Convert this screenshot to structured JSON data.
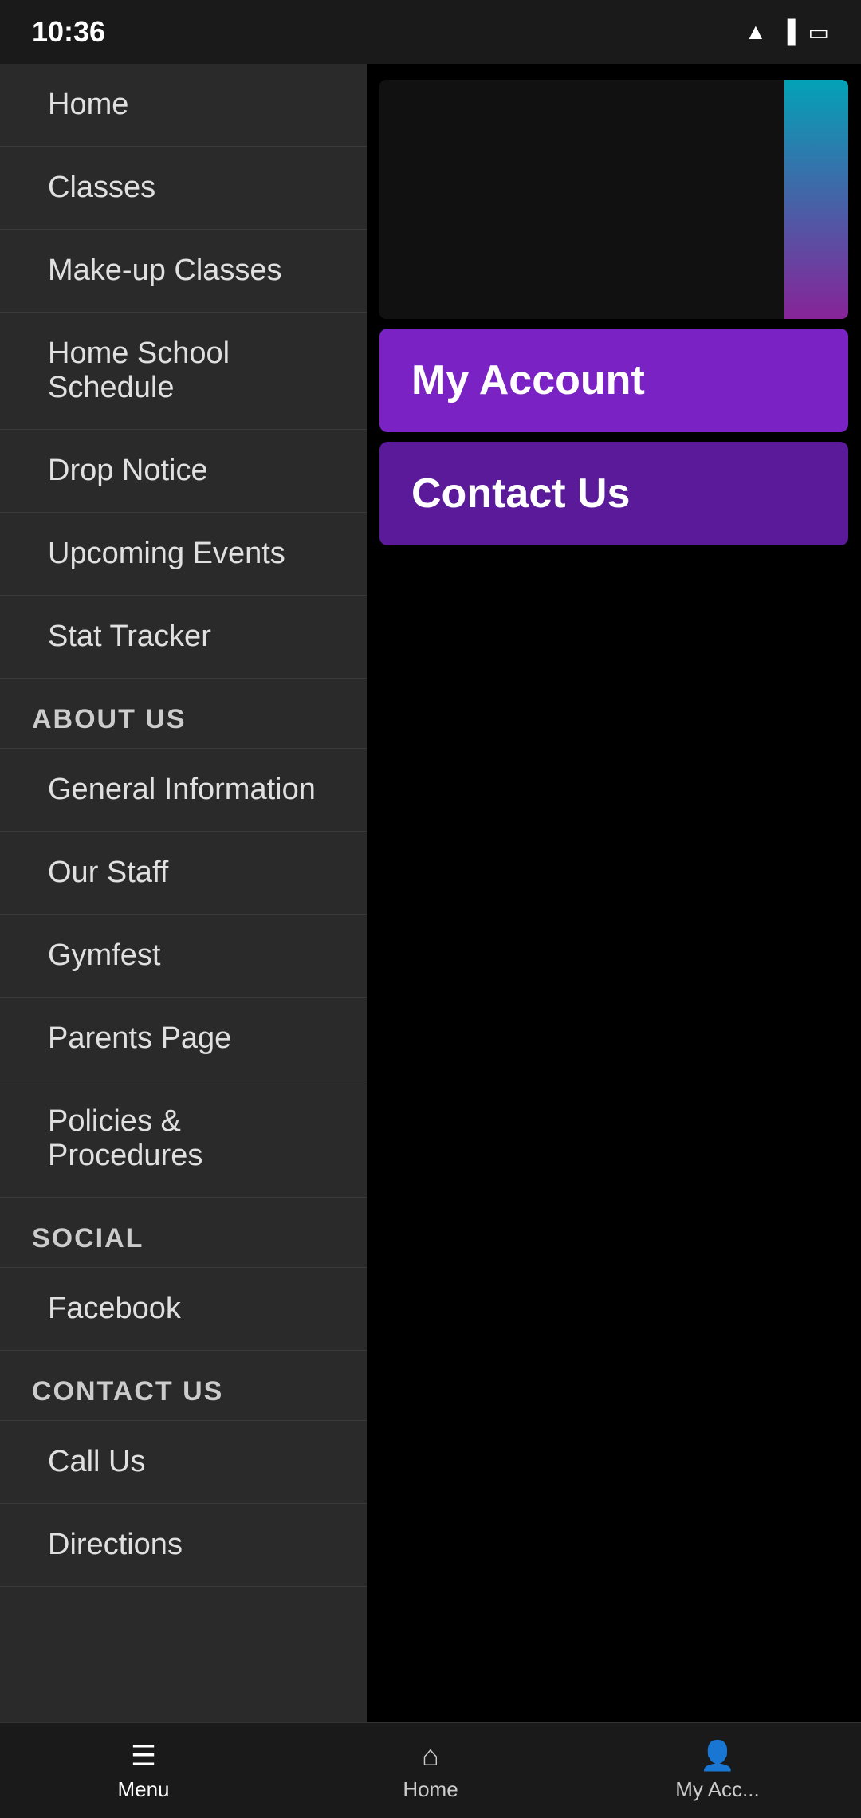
{
  "statusBar": {
    "time": "10:36",
    "icons": [
      "wifi",
      "signal",
      "battery"
    ]
  },
  "menu": {
    "items": [
      {
        "id": "home",
        "label": "Home",
        "section": null
      },
      {
        "id": "classes",
        "label": "Classes",
        "section": null
      },
      {
        "id": "make-up-classes",
        "label": "Make-up Classes",
        "section": null
      },
      {
        "id": "home-school-schedule",
        "label": "Home School Schedule",
        "section": null
      },
      {
        "id": "drop-notice",
        "label": "Drop Notice",
        "section": null
      },
      {
        "id": "upcoming-events",
        "label": "Upcoming Events",
        "section": null
      },
      {
        "id": "stat-tracker",
        "label": "Stat Tracker",
        "section": null
      }
    ],
    "sections": [
      {
        "id": "about-us",
        "label": "ABOUT US",
        "items": [
          {
            "id": "general-information",
            "label": "General Information"
          },
          {
            "id": "our-staff",
            "label": "Our Staff"
          },
          {
            "id": "gymfest",
            "label": "Gymfest"
          },
          {
            "id": "parents-page",
            "label": "Parents Page"
          },
          {
            "id": "policies-procedures",
            "label": "Policies & Procedures"
          }
        ]
      },
      {
        "id": "social",
        "label": "SOCIAL",
        "items": [
          {
            "id": "facebook",
            "label": "Facebook"
          }
        ]
      },
      {
        "id": "contact-us",
        "label": "CONTACT US",
        "items": [
          {
            "id": "call-us",
            "label": "Call Us"
          },
          {
            "id": "directions",
            "label": "Directions"
          }
        ]
      }
    ]
  },
  "rightPanel": {
    "myAccountButton": "My Account",
    "contactUsButton": "Contact Us"
  },
  "bottomNav": {
    "items": [
      {
        "id": "menu",
        "label": "Menu",
        "icon": "☰",
        "active": true
      },
      {
        "id": "home",
        "label": "Home",
        "icon": "⌂",
        "active": false
      },
      {
        "id": "my-account",
        "label": "My Acc...",
        "icon": "👤",
        "active": false
      }
    ]
  }
}
